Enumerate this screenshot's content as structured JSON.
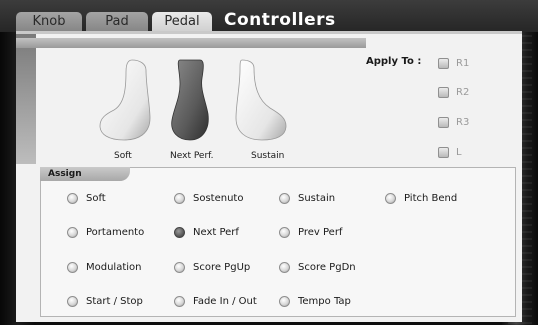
{
  "header": {
    "title": "Controllers",
    "tabs": [
      {
        "label": "Knob",
        "active": false
      },
      {
        "label": "Pad",
        "active": false
      },
      {
        "label": "Pedal",
        "active": true
      }
    ]
  },
  "pedals": [
    {
      "label": "Soft",
      "selected": false
    },
    {
      "label": "Next Perf.",
      "selected": true
    },
    {
      "label": "Sustain",
      "selected": false
    }
  ],
  "apply_to": {
    "label": "Apply To :",
    "parts": [
      "R1",
      "R2",
      "R3",
      "L"
    ]
  },
  "assign": {
    "label": "Assign",
    "selected": "Next Perf",
    "options": [
      "Soft",
      "Sostenuto",
      "Sustain",
      "Pitch Bend",
      "Portamento",
      "Next Perf",
      "Prev Perf",
      "Modulation",
      "Score PgUp",
      "Score PgDn",
      "Start / Stop",
      "Fade In / Out",
      "Tempo Tap"
    ]
  },
  "colors": {
    "background": "#0d0d0d",
    "panel": "#f2f2f2",
    "tab_active": "#e0e0e0",
    "tab_inactive": "#959595",
    "pedal_selected": "#5a5a5a",
    "pedal_normal": "#ffffff",
    "disabled_text": "#9a9a9a"
  }
}
